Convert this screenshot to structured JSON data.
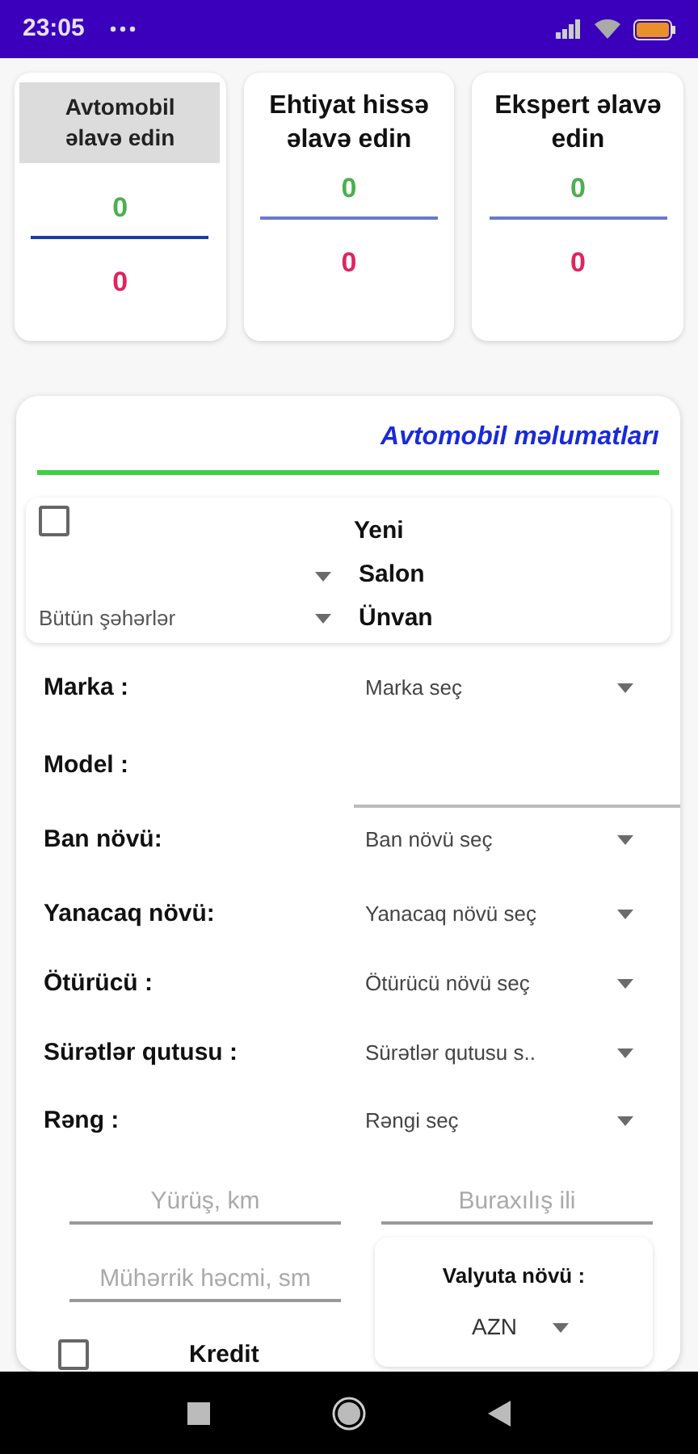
{
  "status_bar": {
    "time": "23:05"
  },
  "summary_cards": [
    {
      "title": "Avtomobil əlavə edin",
      "selected": true,
      "top_count": "0",
      "bottom_count": "0"
    },
    {
      "title": "Ehtiyat hissə əlavə edin",
      "selected": false,
      "top_count": "0",
      "bottom_count": "0"
    },
    {
      "title": "Ekspert əlavə edin",
      "selected": false,
      "top_count": "0",
      "bottom_count": "0"
    }
  ],
  "section_title": "Avtomobil məlumatları",
  "filter_box": {
    "new_checkbox": {
      "checked": false,
      "label": "Yeni"
    },
    "salon_label": "Salon",
    "city_dropdown": {
      "value": "Bütün şəhərlər"
    },
    "address_label": "Ünvan"
  },
  "fields": [
    {
      "kind": "dropdown",
      "label": "Marka :",
      "value": "Marka seç"
    },
    {
      "kind": "text",
      "label": "Model :"
    },
    {
      "kind": "dropdown",
      "label": "Ban növü:",
      "value": "Ban növü seç"
    },
    {
      "kind": "dropdown",
      "label": "Yanacaq növü:",
      "value": "Yanacaq növü seç"
    },
    {
      "kind": "dropdown",
      "label": "Ötürücü :",
      "value": "Ötürücü növü seç"
    },
    {
      "kind": "dropdown",
      "label": "Sürətlər qutusu :",
      "value": "Sürətlər qutusu s.."
    },
    {
      "kind": "dropdown",
      "label": "Rəng :",
      "value": "Rəngi seç"
    }
  ],
  "mileage": {
    "placeholder": "Yürüş, km"
  },
  "year": {
    "placeholder": "Buraxılış ili"
  },
  "engine": {
    "placeholder": "Mühərrik həcmi, sm"
  },
  "currency": {
    "label": "Valyuta növü :",
    "value": "AZN"
  },
  "credit": {
    "checked": false,
    "label": "Kredit"
  }
}
